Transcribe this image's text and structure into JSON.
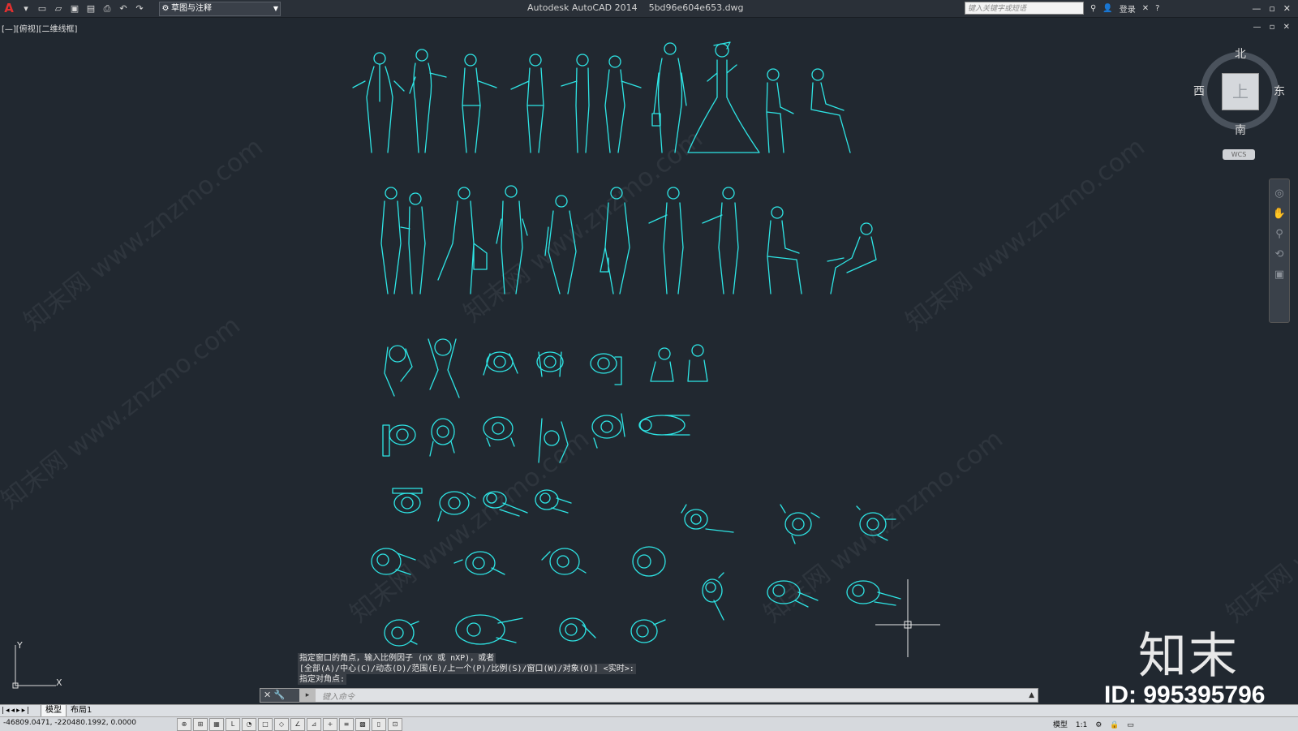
{
  "titlebar": {
    "app_logo": "A",
    "workspace": "草图与注释",
    "title": "Autodesk AutoCAD 2014    5bd96e604e653.dwg",
    "search_placeholder": "键入关键字或短语",
    "login": "登录",
    "help": "?"
  },
  "viewport": {
    "label": "[—][俯视][二维线框]"
  },
  "viewcube": {
    "north": "北",
    "south": "南",
    "east": "东",
    "west": "西",
    "face": "上",
    "wcs": "WCS"
  },
  "ucs": {
    "x_label": "X",
    "y_label": "Y"
  },
  "command": {
    "history": [
      "指定窗口的角点，输入比例因子 (nX 或 nXP)，或者",
      "[全部(A)/中心(C)/动态(D)/范围(E)/上一个(P)/比例(S)/窗口(W)/对象(O)] <实时>:",
      "指定对角点:"
    ],
    "placeholder": "键入命令"
  },
  "tabs": {
    "model": "模型",
    "layout": "布局1"
  },
  "status": {
    "coords": "-46809.0471, -220480.1992, 0.0000",
    "model": "模型",
    "scale": "1:1"
  },
  "watermark": {
    "text": "知末网 www.znzmo.com",
    "logo": "知末",
    "id": "ID: 995395796"
  },
  "colors": {
    "background": "#212830",
    "linework": "#2ee6e6"
  }
}
